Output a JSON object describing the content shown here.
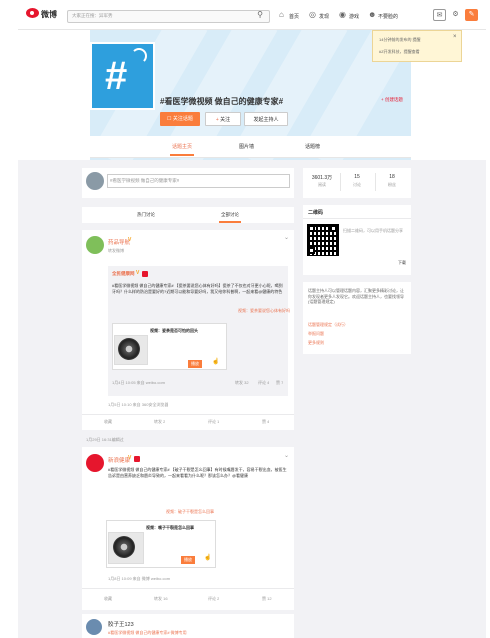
{
  "topbar": {
    "logo": "微博",
    "search_placeholder": "大家正在搜：异军势",
    "nav": [
      "首页",
      "发现",
      "游戏"
    ],
    "user": "不要脸的",
    "colors": {
      "brand": "#e6162d",
      "accent": "#fa7d3c"
    }
  },
  "popup": {
    "line1": "14分钟前的发布的 提醒",
    "line2": "#Z开发科技，提醒查看",
    "close": "×"
  },
  "header": {
    "title": "#看医学微视频 做自己的健康专家#",
    "create_label": "创建话题",
    "buttons": [
      "关注话题",
      "关注",
      "发起主持人"
    ],
    "tabs": [
      "话题主页",
      "图片墙",
      "话题榜"
    ]
  },
  "composer": {
    "placeholder": "#看医学微视频 做自己的健康专家#"
  },
  "feed_tabs": [
    "热门讨论",
    "全部讨论"
  ],
  "stats": [
    {
      "value": "3601.3万",
      "label": "阅读"
    },
    {
      "value": "15",
      "label": "讨论"
    },
    {
      "value": "18",
      "label": "粉丝"
    }
  ],
  "qr": {
    "heading": "二维码",
    "desc": "扫描二维码，可以用手机话题分享",
    "link": "下载"
  },
  "host": {
    "text": "话题主持人可以管理话题内容，汇聚更多精彩讨论，让你发现者更多人发现它。欢迎话题主持人，也要找领导(话题管理规定)",
    "links": [
      "话题管理规定（试行）",
      "举报问题",
      "更多规则"
    ]
  },
  "post1": {
    "name": "药品导航",
    "subtitle": "转发微博",
    "quote_name": "全民健康网",
    "quote_text": "#看医学微视频 做自己的健康专家# 【瓷茶要说您心体有好吗】瓷茶了不仅也对牙更小心呢，喝到牙吗？什么样的防治是要好的?近期可以能和导要好吗，我又给你科普啊，一起来看@健康的特色",
    "link_text": "视频：瓷茶要说您心体有好吗",
    "video_title": "视频：瓷茶是否可怕的回头",
    "play": "播放",
    "quote_time": "1月4日 10:05 来自 weibo.com",
    "quote_counts": [
      "转发 32",
      "评论 4",
      "赞 7"
    ],
    "time": "1月5日 10:10 来自 360安全浏览器",
    "actions": [
      "收藏",
      "转发 2",
      "评论 1",
      "赞 4"
    ]
  },
  "separator": "1月29日 16:31编辑过",
  "post2": {
    "name": "新浪健康",
    "text": "#看医学微视频 做自己的健康专家# 【破子干裂是怎么回事】有时候嘴唇发干，容易干裂出血，被医生告诉是由营养缺乏和唇炎导致的，一起来看看为什么呢？那该怎么办？@看健康",
    "link_text": "视频：破子干裂是怎么回事",
    "video_title": "视频：嘴子干裂是怎么回事",
    "play": "播放",
    "time": "1月8日 10:09 来自 微博 weibo.com",
    "actions": [
      "收藏",
      "转发 16",
      "评论 2",
      "赞 12"
    ]
  },
  "post3": {
    "name": "胶子王123",
    "text": "#看医学微视频 做自己的健康专家# 微博专用"
  }
}
